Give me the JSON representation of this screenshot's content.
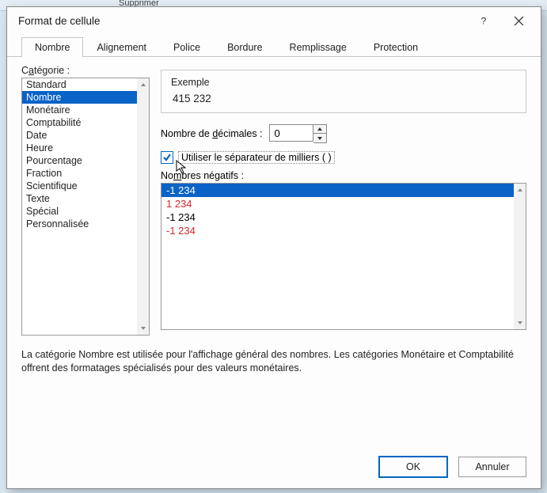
{
  "ribbon": {
    "supprimer": "Supprimer"
  },
  "dialog": {
    "title": "Format de cellule",
    "tabs": [
      "Nombre",
      "Alignement",
      "Police",
      "Bordure",
      "Remplissage",
      "Protection"
    ],
    "active_tab_index": 0,
    "category_label_pre": "C",
    "category_label_ul": "a",
    "category_label_post": "tégorie :",
    "categories": [
      "Standard",
      "Nombre",
      "Monétaire",
      "Comptabilité",
      "Date",
      "Heure",
      "Pourcentage",
      "Fraction",
      "Scientifique",
      "Texte",
      "Spécial",
      "Personnalisée"
    ],
    "selected_category_index": 1,
    "example": {
      "label": "Exemple",
      "value": "415 232"
    },
    "decimals": {
      "label_pre": "Nombre de ",
      "label_ul": "d",
      "label_post": "écimales :",
      "value": "0"
    },
    "thousand_sep": {
      "checked": true,
      "label": "Utiliser le séparateur de milliers ( )"
    },
    "negatives": {
      "label_pre": "No",
      "label_ul": "m",
      "label_post": "bres négatifs :",
      "items": [
        {
          "text": "-1 234",
          "color": "normal",
          "selected": true
        },
        {
          "text": "1 234",
          "color": "red",
          "selected": false
        },
        {
          "text": "-1 234",
          "color": "normal",
          "selected": false
        },
        {
          "text": "-1 234",
          "color": "red",
          "selected": false
        }
      ]
    },
    "description": "La catégorie Nombre est utilisée pour l'affichage général des nombres. Les catégories Monétaire et Comptabilité offrent des formatages spécialisés pour des valeurs monétaires.",
    "buttons": {
      "ok": "OK",
      "cancel": "Annuler"
    }
  }
}
